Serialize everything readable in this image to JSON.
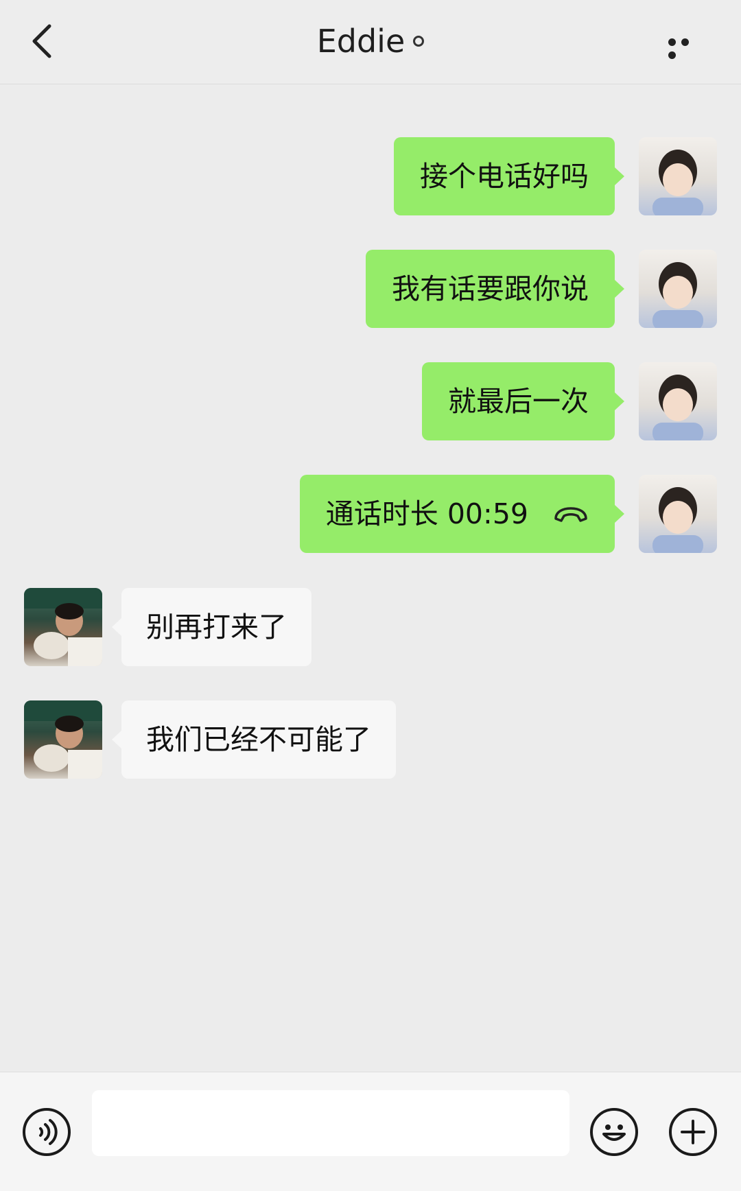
{
  "header": {
    "title": "Eddie",
    "back_icon": "chevron-left-icon",
    "more_icon": "ellipsis-icon"
  },
  "messages": [
    {
      "side": "sent",
      "text": "接个电话好吗"
    },
    {
      "side": "sent",
      "text": "我有话要跟你说"
    },
    {
      "side": "sent",
      "text": "就最后一次"
    },
    {
      "side": "sent",
      "text": "通话时长 00:59",
      "icon": "phone-hangup-icon"
    },
    {
      "side": "received",
      "text": "别再打来了"
    },
    {
      "side": "received",
      "text": "我们已经不可能了"
    }
  ],
  "footer": {
    "voice_icon": "voice-icon",
    "emoji_icon": "emoji-icon",
    "plus_icon": "plus-icon"
  },
  "colors": {
    "sent_bubble": "#95ec69",
    "received_bubble": "#f7f7f7",
    "background": "#ececec"
  }
}
